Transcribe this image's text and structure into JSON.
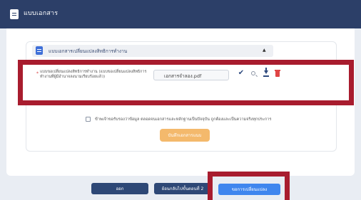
{
  "header": {
    "title": "แบบเอกสาร",
    "icon": "document-icon"
  },
  "section": {
    "title": "แบบเอกสารเปลี่ยนแปลงสิทธิการทำงาน",
    "icon": "document-icon"
  },
  "upload_row": {
    "required_mark": "*",
    "label": "แบบขอเปลี่ยนแปลงสิทธิการทำงาน (แบบขอเปลี่ยนแปลงสิทธิการทำงานที่ผู้มีอำนาจลงนามเรียบร้อยแล้ว)",
    "file_name": "เอกสารจำลอง.pdf",
    "actions": [
      "check-icon",
      "zoom-icon",
      "download-icon",
      "trash-icon"
    ]
  },
  "consent": {
    "text": "ข้าพเจ้าขอรับรองว่าข้อมูล ตลอดจนเอกสารและหลักฐานเป็นปัจจุบัน ถูกต้องและเป็นความจริงทุกประการ"
  },
  "save_button": "บันทึกเอกสารแนบ",
  "footer": {
    "exit_button": "ออก",
    "back_button": "ย้อนกลับไปขั้นตอนที่ 2",
    "submit_button": "ขอการเปลี่ยนแปลง"
  },
  "colors": {
    "header": "#2c3f68",
    "highlight": "#a81c2e",
    "primary": "#3f86ee",
    "save": "#f4b96c"
  }
}
